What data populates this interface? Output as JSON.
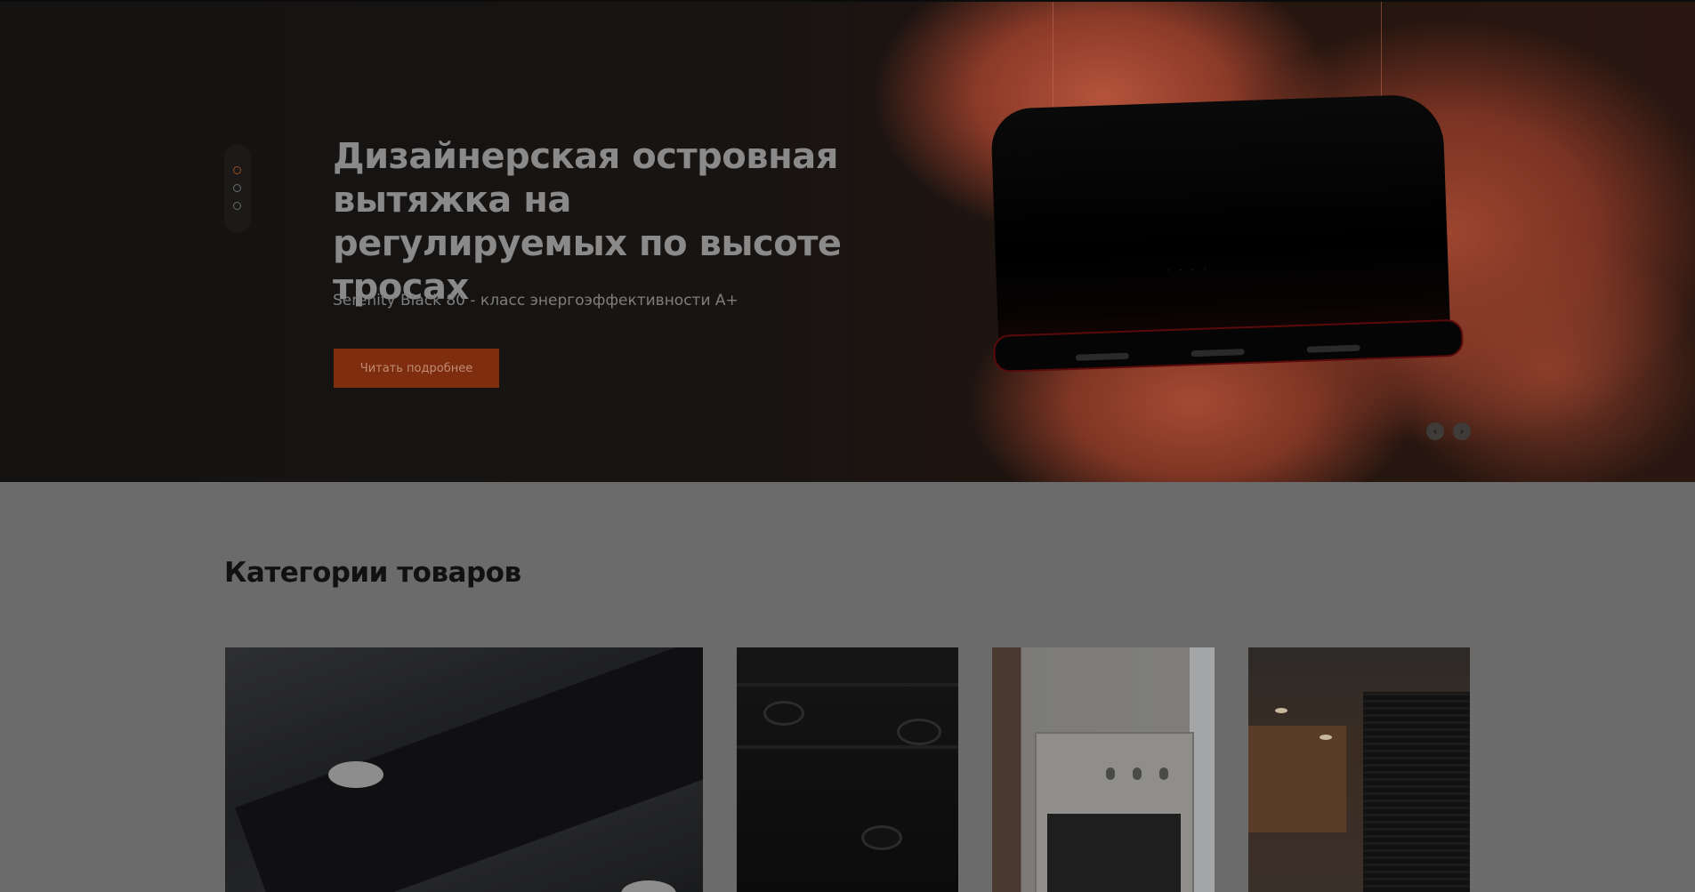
{
  "hero": {
    "title": "Дизайнерская островная вытяжка на регулируемых по высоте тросах",
    "subtitle": "Serenity Black 80 - класс энергоэффективности A+",
    "button_label": "Читать подробнее",
    "slides_total": 3,
    "active_slide": 1,
    "prev_icon": "‹",
    "next_icon": "›"
  },
  "categories": {
    "title": "Категории товаров",
    "cards": [
      {
        "icon": "range-hood-photo"
      },
      {
        "icon": "gas-hob-photo"
      },
      {
        "icon": "built-in-oven-photo"
      },
      {
        "icon": "kitchen-interior-photo"
      }
    ]
  },
  "colors": {
    "accent": "#7e2e0e",
    "hero_bg": "#141312",
    "page_bg": "#6b6b6b"
  }
}
